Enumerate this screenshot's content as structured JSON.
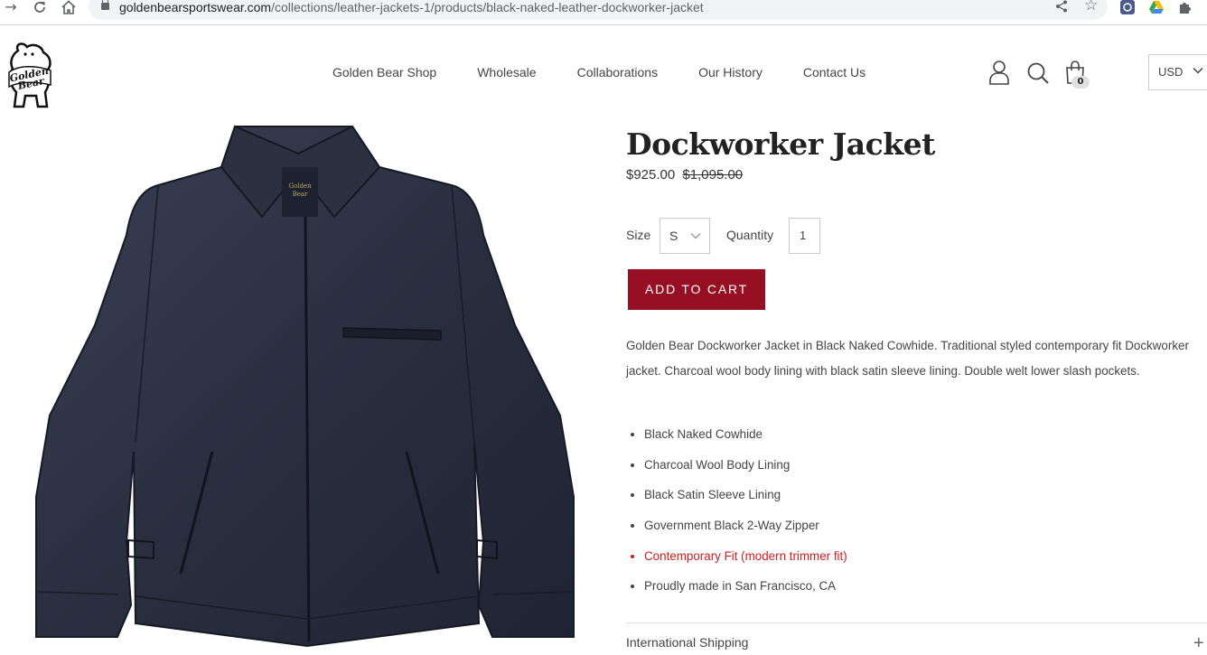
{
  "browser": {
    "url_domain": "goldenbearsportswear.com",
    "url_path": "/collections/leather-jackets-1/products/black-naked-leather-dockworker-jacket"
  },
  "header": {
    "nav": [
      "Golden Bear Shop",
      "Wholesale",
      "Collaborations",
      "Our History",
      "Contact Us"
    ],
    "cart_count": "0",
    "currency": "USD"
  },
  "product": {
    "title": "Dockworker Jacket",
    "price": "$925.00",
    "compare_price": "$1,095.00",
    "size_label": "Size",
    "size_value": "S",
    "quantity_label": "Quantity",
    "quantity_value": "1",
    "add_to_cart": "ADD TO CART",
    "description": "Golden Bear Dockworker Jacket in Black Naked Cowhide. Traditional styled contemporary fit Dockworker jacket. Charcoal wool body lining with black satin sleeve lining. Double welt lower slash pockets.",
    "features": [
      "Black Naked Cowhide",
      "Charcoal Wool Body Lining",
      "Black Satin Sleeve Lining",
      "Government Black 2-Way Zipper",
      "Contemporary Fit (modern trimmer fit)",
      "Proudly made in San Francisco, CA"
    ],
    "accordion_title": "International Shipping"
  },
  "colors": {
    "accent_button": "#960f22",
    "highlight_text": "#d21c1c"
  }
}
